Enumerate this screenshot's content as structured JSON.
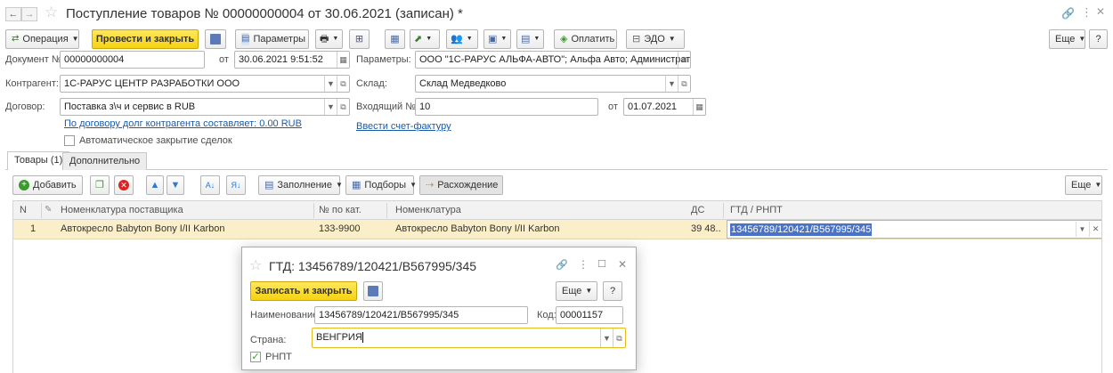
{
  "window": {
    "title": "Поступление товаров № 00000000004 от 30.06.2021 (записан) *"
  },
  "toolbar": {
    "operation": "Операция",
    "post_and_close": "Провести и закрыть",
    "params": "Параметры",
    "pay": "Оплатить",
    "edo": "ЭДО",
    "more": "Еще",
    "help": "?"
  },
  "form": {
    "doc_no_label": "Документ №:",
    "doc_no": "00000000004",
    "from_label": "от",
    "date": "30.06.2021  9:51:52",
    "params_label": "Параметры:",
    "params_value": "ООО \"1С-РАРУС АЛЬФА-АВТО\"; Альфа Авто; Администратор",
    "counterparty_label": "Контрагент:",
    "counterparty": "1С-РАРУС ЦЕНТР РАЗРАБОТКИ ООО",
    "warehouse_label": "Склад:",
    "warehouse": "Склад Медведково",
    "contract_label": "Договор:",
    "contract": "Поставка з\\ч и сервис в RUB",
    "incoming_label": "Входящий №:",
    "incoming_no": "10",
    "incoming_from_label": "от",
    "incoming_date": "01.07.2021",
    "debt_link": "По договору долг контрагента составляет: 0.00 RUB",
    "invoice_link": "Ввести счет-фактуру",
    "auto_close_label": "Автоматическое закрытие сделок"
  },
  "tabs": [
    {
      "label": "Товары (1)"
    },
    {
      "label": "Дополнительно"
    }
  ],
  "table_toolbar": {
    "add": "Добавить",
    "fill": "Заполнение",
    "picks": "Подборы",
    "discrepancy": "Расхождение",
    "more": "Еще"
  },
  "table": {
    "headers": {
      "n": "N",
      "supplier_item": "Номенклатура поставщика",
      "cat_no": "№ по кат.",
      "item": "Номенклатура",
      "vat": "ДС",
      "gtd": "ГТД / РНПТ"
    },
    "rows": [
      {
        "n": "1",
        "supplier_item": "Автокресло Babyton Bony I/II Karbon",
        "cat_no": "133-9900",
        "item": "Автокресло Babyton Bony I/II Karbon",
        "vat": "39 48...",
        "gtd": "13456789/120421/B567995/345"
      }
    ]
  },
  "dialog": {
    "title": "ГТД: 13456789/120421/B567995/345",
    "save_close": "Записать и закрыть",
    "more": "Еще",
    "help": "?",
    "name_label": "Наименование:",
    "name": "13456789/120421/B567995/345",
    "code_label": "Код:",
    "code": "00001157",
    "country_label": "Страна:",
    "country": "ВЕНГРИЯ",
    "rnpt_label": "РНПТ"
  },
  "colors": {
    "accent_yellow": "#f6d211",
    "row_highlight": "#fbefc9",
    "link": "#1a5ba8",
    "selection": "#4a73c8"
  }
}
